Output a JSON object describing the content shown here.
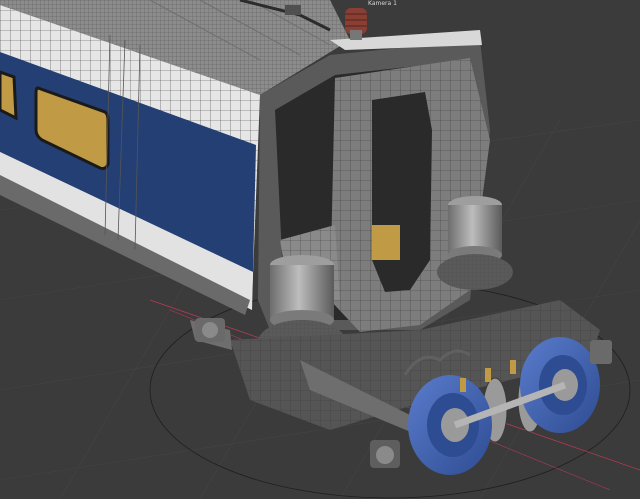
{
  "viewport": {
    "camera_label": "Kamera 1",
    "background_color": "#3b3b3b",
    "grid_color": "#454545",
    "colors": {
      "car_blue": "#243f74",
      "car_white": "#e8e8e8",
      "wheel_blue": "#3f63b0",
      "window_amber": "#c09a45",
      "mesh_gray": "#8a8a8a",
      "axis_red": "#b33a55"
    }
  }
}
